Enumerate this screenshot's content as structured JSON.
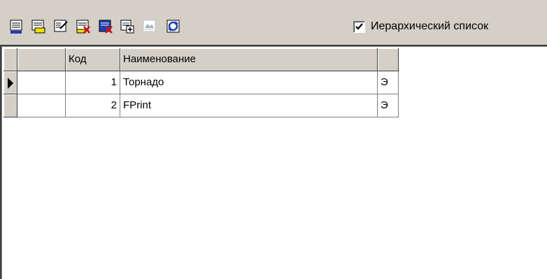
{
  "toolbar": {
    "buttons": [
      {
        "icon": "add-record-icon"
      },
      {
        "icon": "add-folder-icon"
      },
      {
        "icon": "edit-record-icon"
      },
      {
        "icon": "delete-folder-icon"
      },
      {
        "icon": "delete-record-icon"
      },
      {
        "icon": "copy-record-icon"
      },
      {
        "icon": "filter-icon"
      },
      {
        "icon": "refresh-icon"
      }
    ],
    "hierarchical_checked": true,
    "hierarchical_label": "Иерархический список"
  },
  "grid": {
    "columns": {
      "indicator": "",
      "blank": "",
      "code": "Код",
      "name": "Наименование",
      "type": ""
    },
    "rows": [
      {
        "code": "1",
        "name": "Торнадо",
        "type": "Э",
        "current": true
      },
      {
        "code": "2",
        "name": "FPrint",
        "type": "Э",
        "current": false
      }
    ]
  },
  "colors": {
    "face": "#d4d0c8",
    "shadow": "#808080",
    "dark": "#404040",
    "accent_blue": "#1c3fb5",
    "accent_red": "#d01010",
    "accent_yellow": "#f2e000"
  }
}
